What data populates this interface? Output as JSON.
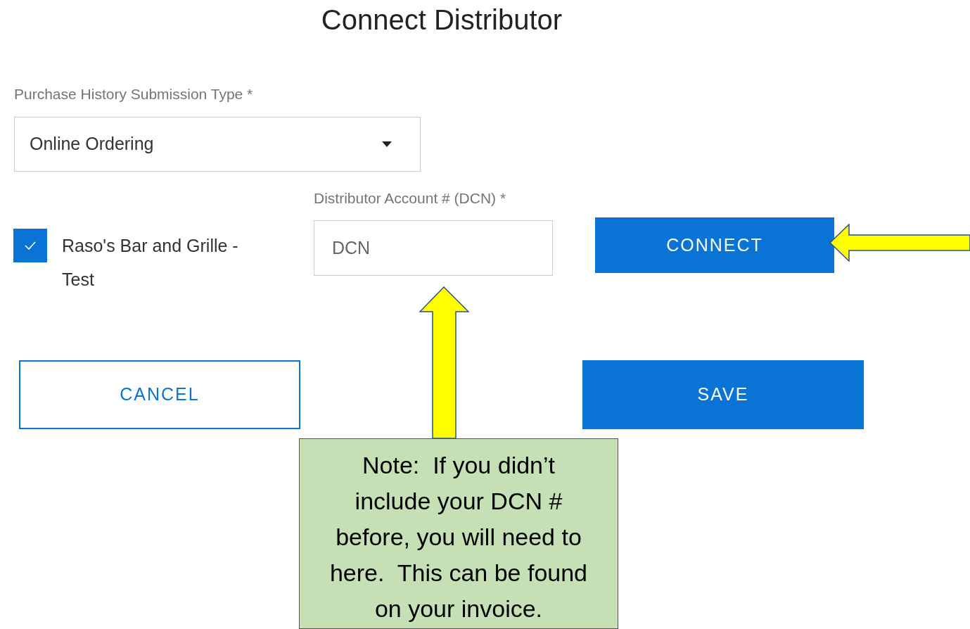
{
  "title": "Connect Distributor",
  "submission_type": {
    "label": "Purchase History Submission Type *",
    "value": "Online Ordering"
  },
  "location": {
    "label": "Raso's Bar and Grille - Test",
    "checked": true
  },
  "dcn": {
    "label": "Distributor Account # (DCN) *",
    "placeholder": "DCN"
  },
  "connect_button": "CONNECT",
  "buttons": [
    {
      "label": "CANCEL",
      "kind": "outline"
    },
    {
      "label": "SAVE",
      "kind": "filled"
    }
  ],
  "note": "Note:  If you didn’t\ninclude your DCN #\nbefore, you will need to\nhere.  This can be found\non your invoice."
}
